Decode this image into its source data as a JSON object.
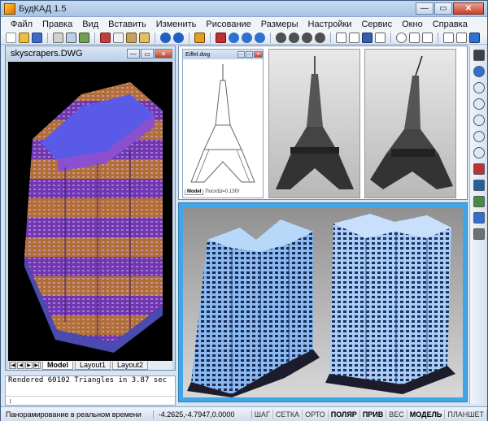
{
  "window": {
    "title": "БудКАД 1.5"
  },
  "menu": {
    "items": [
      "Файл",
      "Правка",
      "Вид",
      "Вставить",
      "Изменить",
      "Рисование",
      "Размеры",
      "Настройки",
      "Сервис",
      "Окно",
      "Справка"
    ]
  },
  "drawing_window": {
    "title": "skyscrapers.DWG",
    "tabs": [
      "Model",
      "Layout1",
      "Layout2"
    ]
  },
  "eiffel_window": {
    "title": "Eiffel.dwg",
    "tab": "Model",
    "coord": "Посх/Ш=0.1Збт"
  },
  "command": {
    "history": [
      "Rendered 60102 Triangles in 3.87 sec"
    ],
    "prompt": ":"
  },
  "status": {
    "message": "Панорамирование в реальном времени",
    "coords": "-4.2625,-4.7947,0.0000",
    "flags": [
      {
        "label": "ШАГ",
        "on": false
      },
      {
        "label": "СЕТКА",
        "on": false
      },
      {
        "label": "ОРТО",
        "on": false
      },
      {
        "label": "ПОЛЯР",
        "on": true
      },
      {
        "label": "ПРИВ",
        "on": true
      },
      {
        "label": "ВЕС",
        "on": false
      },
      {
        "label": "МОДЕЛЬ",
        "on": true
      },
      {
        "label": "ПЛАНШЕТ",
        "on": false
      }
    ]
  },
  "colors": {
    "accent_frame": "#3fa7e8",
    "building_purple": "#8a4fd0",
    "building_orange": "#d88a4a",
    "building_blue": "#8ab8f0"
  }
}
